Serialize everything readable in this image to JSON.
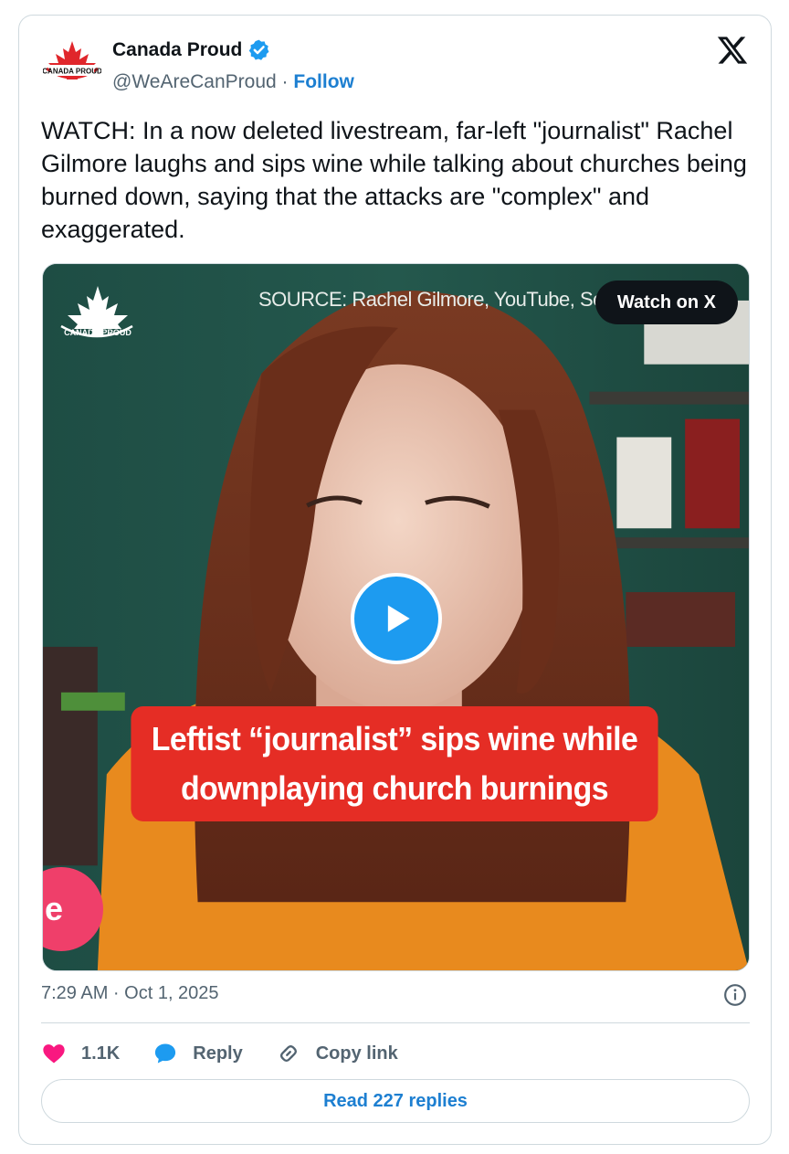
{
  "author": {
    "display_name": "Canada Proud",
    "handle": "@WeAreCanProud",
    "separator": "·",
    "follow_label": "Follow",
    "verified": true,
    "logo_text": "CANADA PROUD"
  },
  "tweet": {
    "text": "WATCH: In a now deleted livestream, far-left \"journalist\" Rachel Gilmore laughs and sips wine while talking about churches being burned down, saying that the attacks are \"complex\" and exaggerated."
  },
  "media": {
    "watermark_text": "CANADA PROUD",
    "source_text": "SOURCE: Rachel Gilmore, YouTube, Septe",
    "watch_button_label": "Watch on X",
    "caption_line1": "Leftist “journalist” sips wine while",
    "caption_line2": "downplaying church burnings",
    "pink_circle_letter": "e"
  },
  "meta": {
    "timestamp": "7:29 AM · Oct 1, 2025"
  },
  "actions": {
    "like_count": "1.1K",
    "reply_label": "Reply",
    "copy_link_label": "Copy link"
  },
  "read_replies_label": "Read 227 replies",
  "colors": {
    "brand_blue": "#1d9bf0",
    "link_blue": "#1d7fd1",
    "like_pink": "#f91880",
    "caption_red": "#e52d25",
    "maple_red": "#e0262b"
  },
  "icons": {
    "x_logo": "x-logo-icon",
    "verified": "verified-badge-icon",
    "info": "info-icon",
    "like": "heart-icon",
    "reply": "speech-bubble-icon",
    "copy": "link-icon",
    "play": "play-icon"
  }
}
